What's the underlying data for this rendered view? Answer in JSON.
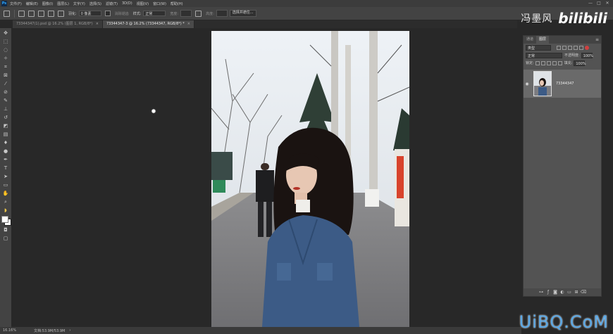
{
  "menubar": {
    "logo": "Ps",
    "items": [
      "文件(F)",
      "编辑(E)",
      "图像(I)",
      "图层(L)",
      "文字(Y)",
      "选择(S)",
      "滤镜(T)",
      "3D(D)",
      "视图(V)",
      "窗口(W)",
      "帮助(H)"
    ],
    "window_controls": [
      "—",
      "□",
      "✕"
    ]
  },
  "options": {
    "feather_label": "羽化:",
    "feather_value": "0 像素",
    "antialias_label": "消除锯齿",
    "style_label": "样式:",
    "style_value": "正常",
    "width_label": "宽度:",
    "height_label": "高度:",
    "select_mask_label": "选择并遮住..."
  },
  "watermark": {
    "text_cn": "冯墨风",
    "text_logo": "bilibili"
  },
  "tabs": [
    {
      "label": "73344347(1).psd @ 16.2% (图层 1, RGB/8*)",
      "close": "×",
      "active": false
    },
    {
      "label": "73344347-3 @ 16.2% (73344347, RGB/8*) *",
      "close": "×",
      "active": true
    }
  ],
  "layers_panel": {
    "tab_channels": "通道",
    "tab_layers": "图层",
    "menu_icon": "≡",
    "filter_kind": "类型",
    "blend_mode": "正常",
    "opacity_label": "不透明度:",
    "opacity_value": "100%",
    "lock_label": "锁定:",
    "fill_label": "填充:",
    "fill_value": "100%",
    "layer_name": "73344347",
    "footer_icons": [
      "link-icon",
      "fx-icon",
      "mask-icon",
      "adjustment-icon",
      "folder-icon",
      "new-layer-icon",
      "trash-icon"
    ]
  },
  "status": {
    "zoom": "16.16%",
    "doc": "文档:53.9M/53.9M",
    "arrow": "›"
  },
  "site_watermark": "UiBQ.CoM"
}
